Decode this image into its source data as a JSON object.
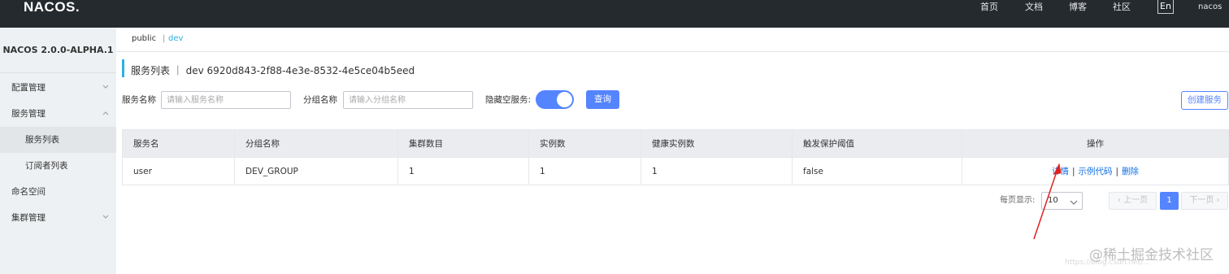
{
  "header": {
    "logo": "NACOS.",
    "nav": [
      "首页",
      "文档",
      "博客",
      "社区"
    ],
    "lang": "En",
    "user": "nacos"
  },
  "sidebar": {
    "title": "NACOS 2.0.0-ALPHA.1",
    "items": [
      {
        "label": "配置管理"
      },
      {
        "label": "服务管理"
      },
      {
        "label": "服务列表"
      },
      {
        "label": "订阅者列表"
      },
      {
        "label": "命名空间"
      },
      {
        "label": "集群管理"
      }
    ]
  },
  "namespaces": {
    "public": "public",
    "separator": "|",
    "current": "dev"
  },
  "page": {
    "title": "服务列表 ｜ dev  6920d843-2f88-4e3e-8532-4e5ce04b5eed"
  },
  "filters": {
    "service_name_label": "服务名称",
    "service_name_placeholder": "请输入服务名称",
    "group_name_label": "分组名称",
    "group_name_placeholder": "请输入分组名称",
    "hide_empty_label": "隐藏空服务:",
    "hide_empty_on": true,
    "query_label": "查询",
    "create_label": "创建服务"
  },
  "table": {
    "columns": [
      "服务名",
      "分组名称",
      "集群数目",
      "实例数",
      "健康实例数",
      "触发保护阈值",
      "操作"
    ],
    "rows": [
      {
        "service": "user",
        "group": "DEV_GROUP",
        "clusters": "1",
        "instances": "1",
        "healthy": "1",
        "threshold": "false"
      }
    ],
    "operations": {
      "detail": "详情",
      "sample_code": "示例代码",
      "delete": "删除",
      "sep": "|"
    }
  },
  "pagination": {
    "per_page_label": "每页显示:",
    "per_page_value": "10",
    "prev": "上一页",
    "current": "1",
    "next": "下一页"
  },
  "watermark": {
    "text": "@稀土掘金技术社区",
    "url": "https://blog.csdn.net/..."
  },
  "colors": {
    "header_bg": "#252a2f",
    "primary": "#5584ff",
    "link": "#1170e5",
    "accent": "#2bb1e4",
    "annotation": "#e02020"
  }
}
